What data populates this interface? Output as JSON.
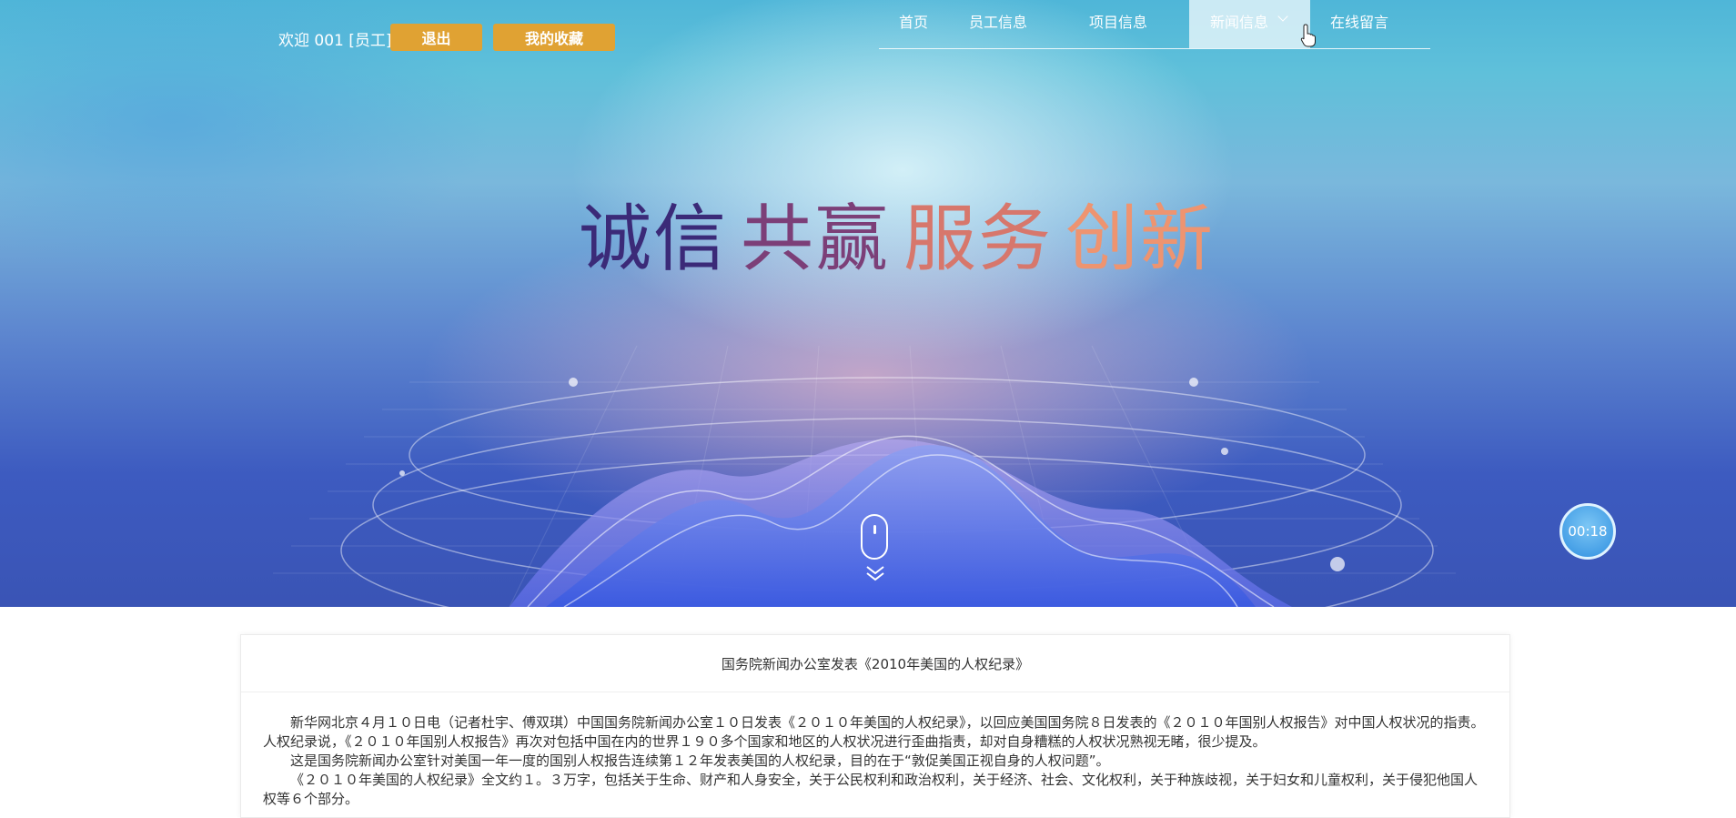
{
  "header": {
    "welcome": "欢迎 001 [员工]",
    "logout_label": "退出",
    "favorites_label": "我的收藏"
  },
  "nav": {
    "items": [
      {
        "label": "首页"
      },
      {
        "label": "员工信息"
      },
      {
        "label": "项目信息"
      },
      {
        "label": "新闻信息"
      },
      {
        "label": "在线留言"
      }
    ],
    "active": "新闻信息"
  },
  "hero": {
    "slogans": [
      "诚信",
      "共赢",
      "服务",
      "创新"
    ],
    "slogan_colors": [
      "#3b2a78",
      "#7c3f78",
      "#d7776c",
      "#ee9470"
    ]
  },
  "timer": {
    "text": "00:18"
  },
  "article": {
    "title": "国务院新闻办公室发表《2010年美国的人权纪录》",
    "paragraphs": [
      "新华网北京４月１０日电（记者杜宇、傅双琪）中国国务院新闻办公室１０日发表《２０１０年美国的人权纪录》，以回应美国国务院８日发表的《２０１０年国别人权报告》对中国人权状况的指责。人权纪录说，《２０１０年国别人权报告》再次对包括中国在内的世界１９０多个国家和地区的人权状况进行歪曲指责，却对自身糟糕的人权状况熟视无睹，很少提及。",
      "这是国务院新闻办公室针对美国一年一度的国别人权报告连续第１２年发表美国的人权纪录，目的在于“敦促美国正视自身的人权问题”。",
      "《２０１０年美国的人权纪录》全文约１。３万字，包括关于生命、财产和人身安全，关于公民权利和政治权利，关于经济、社会、文化权利，关于种族歧视，关于妇女和儿童权利，关于侵犯他国人权等６个部分。"
    ]
  },
  "colors": {
    "accent_button": "#e0a233",
    "nav_active_bg": "#e6f5fa",
    "timer": "#2f8fe0"
  }
}
